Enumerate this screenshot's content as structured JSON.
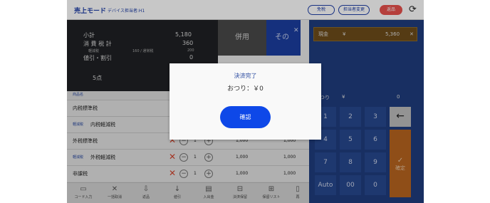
{
  "header": {
    "title": "売上モード",
    "subtitle": "デバイス担当者:H1",
    "btn_a": "免税",
    "btn_b": "担当者変更",
    "btn_c": "返品"
  },
  "totals": {
    "subtotal_label": "小計",
    "subtotal_value": "5,180",
    "tax_label": "消 費 税 計",
    "tax_value": "360",
    "reduced_label": "軽減税",
    "reduced_mid": "160 / 通常税",
    "reduced_value": "200",
    "discount_label": "値引・割引",
    "discount_value": "0",
    "count": "5点"
  },
  "payment": {
    "combined_label": "併用",
    "other_label": "その",
    "cash_label": "現金",
    "cash_currency": "¥",
    "cash_value": "5,360",
    "change_label": "おつり",
    "change_currency": "¥",
    "change_value": "0"
  },
  "keypad": {
    "keys": [
      "1",
      "2",
      "3",
      "4",
      "5",
      "6",
      "7",
      "8",
      "9",
      "Auto",
      "00",
      "0"
    ],
    "confirm_label": "確定"
  },
  "items": {
    "column_header": "商品名",
    "rows": [
      {
        "tag": "",
        "name": "内税標準税",
        "qty": "",
        "price": "",
        "total": ""
      },
      {
        "tag": "軽減税",
        "name": "内税軽減税",
        "qty": "",
        "price": "",
        "total": ""
      },
      {
        "tag": "",
        "name": "外税標準税",
        "qty": "1",
        "price": "1,000",
        "total": "1,000"
      },
      {
        "tag": "軽減税",
        "name": "外税軽減税",
        "qty": "1",
        "price": "1,000",
        "total": "1,000"
      },
      {
        "tag": "",
        "name": "非課税",
        "qty": "1",
        "price": "1,000",
        "total": "1,000"
      }
    ]
  },
  "toolbar": [
    "コード入力",
    "一括取消",
    "返品",
    "値引",
    "入出金",
    "決済保留",
    "保留リスト",
    "再"
  ],
  "modal": {
    "title": "決済完了",
    "message": "おつり：￥0",
    "confirm": "確認"
  }
}
